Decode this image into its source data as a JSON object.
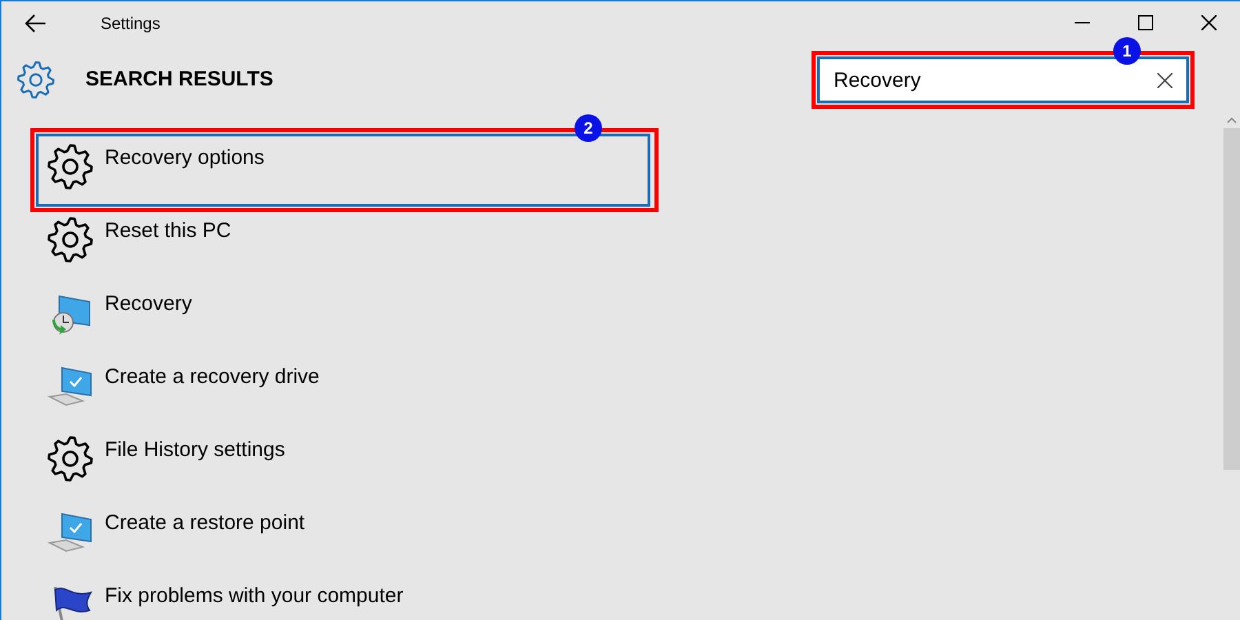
{
  "window": {
    "title": "Settings"
  },
  "header": {
    "title": "SEARCH RESULTS"
  },
  "search": {
    "value": "Recovery",
    "annotation": "1"
  },
  "results": [
    {
      "label": "Recovery options",
      "kind": "gear",
      "selected": true,
      "annotation": "2"
    },
    {
      "label": "Reset this PC",
      "kind": "gear",
      "selected": false
    },
    {
      "label": "Recovery",
      "kind": "restore",
      "selected": false
    },
    {
      "label": "Create a recovery drive",
      "kind": "monitor",
      "selected": false
    },
    {
      "label": "File History settings",
      "kind": "gear",
      "selected": false
    },
    {
      "label": "Create a restore point",
      "kind": "monitor",
      "selected": false
    },
    {
      "label": "Fix problems with your computer",
      "kind": "flag",
      "selected": false
    }
  ]
}
